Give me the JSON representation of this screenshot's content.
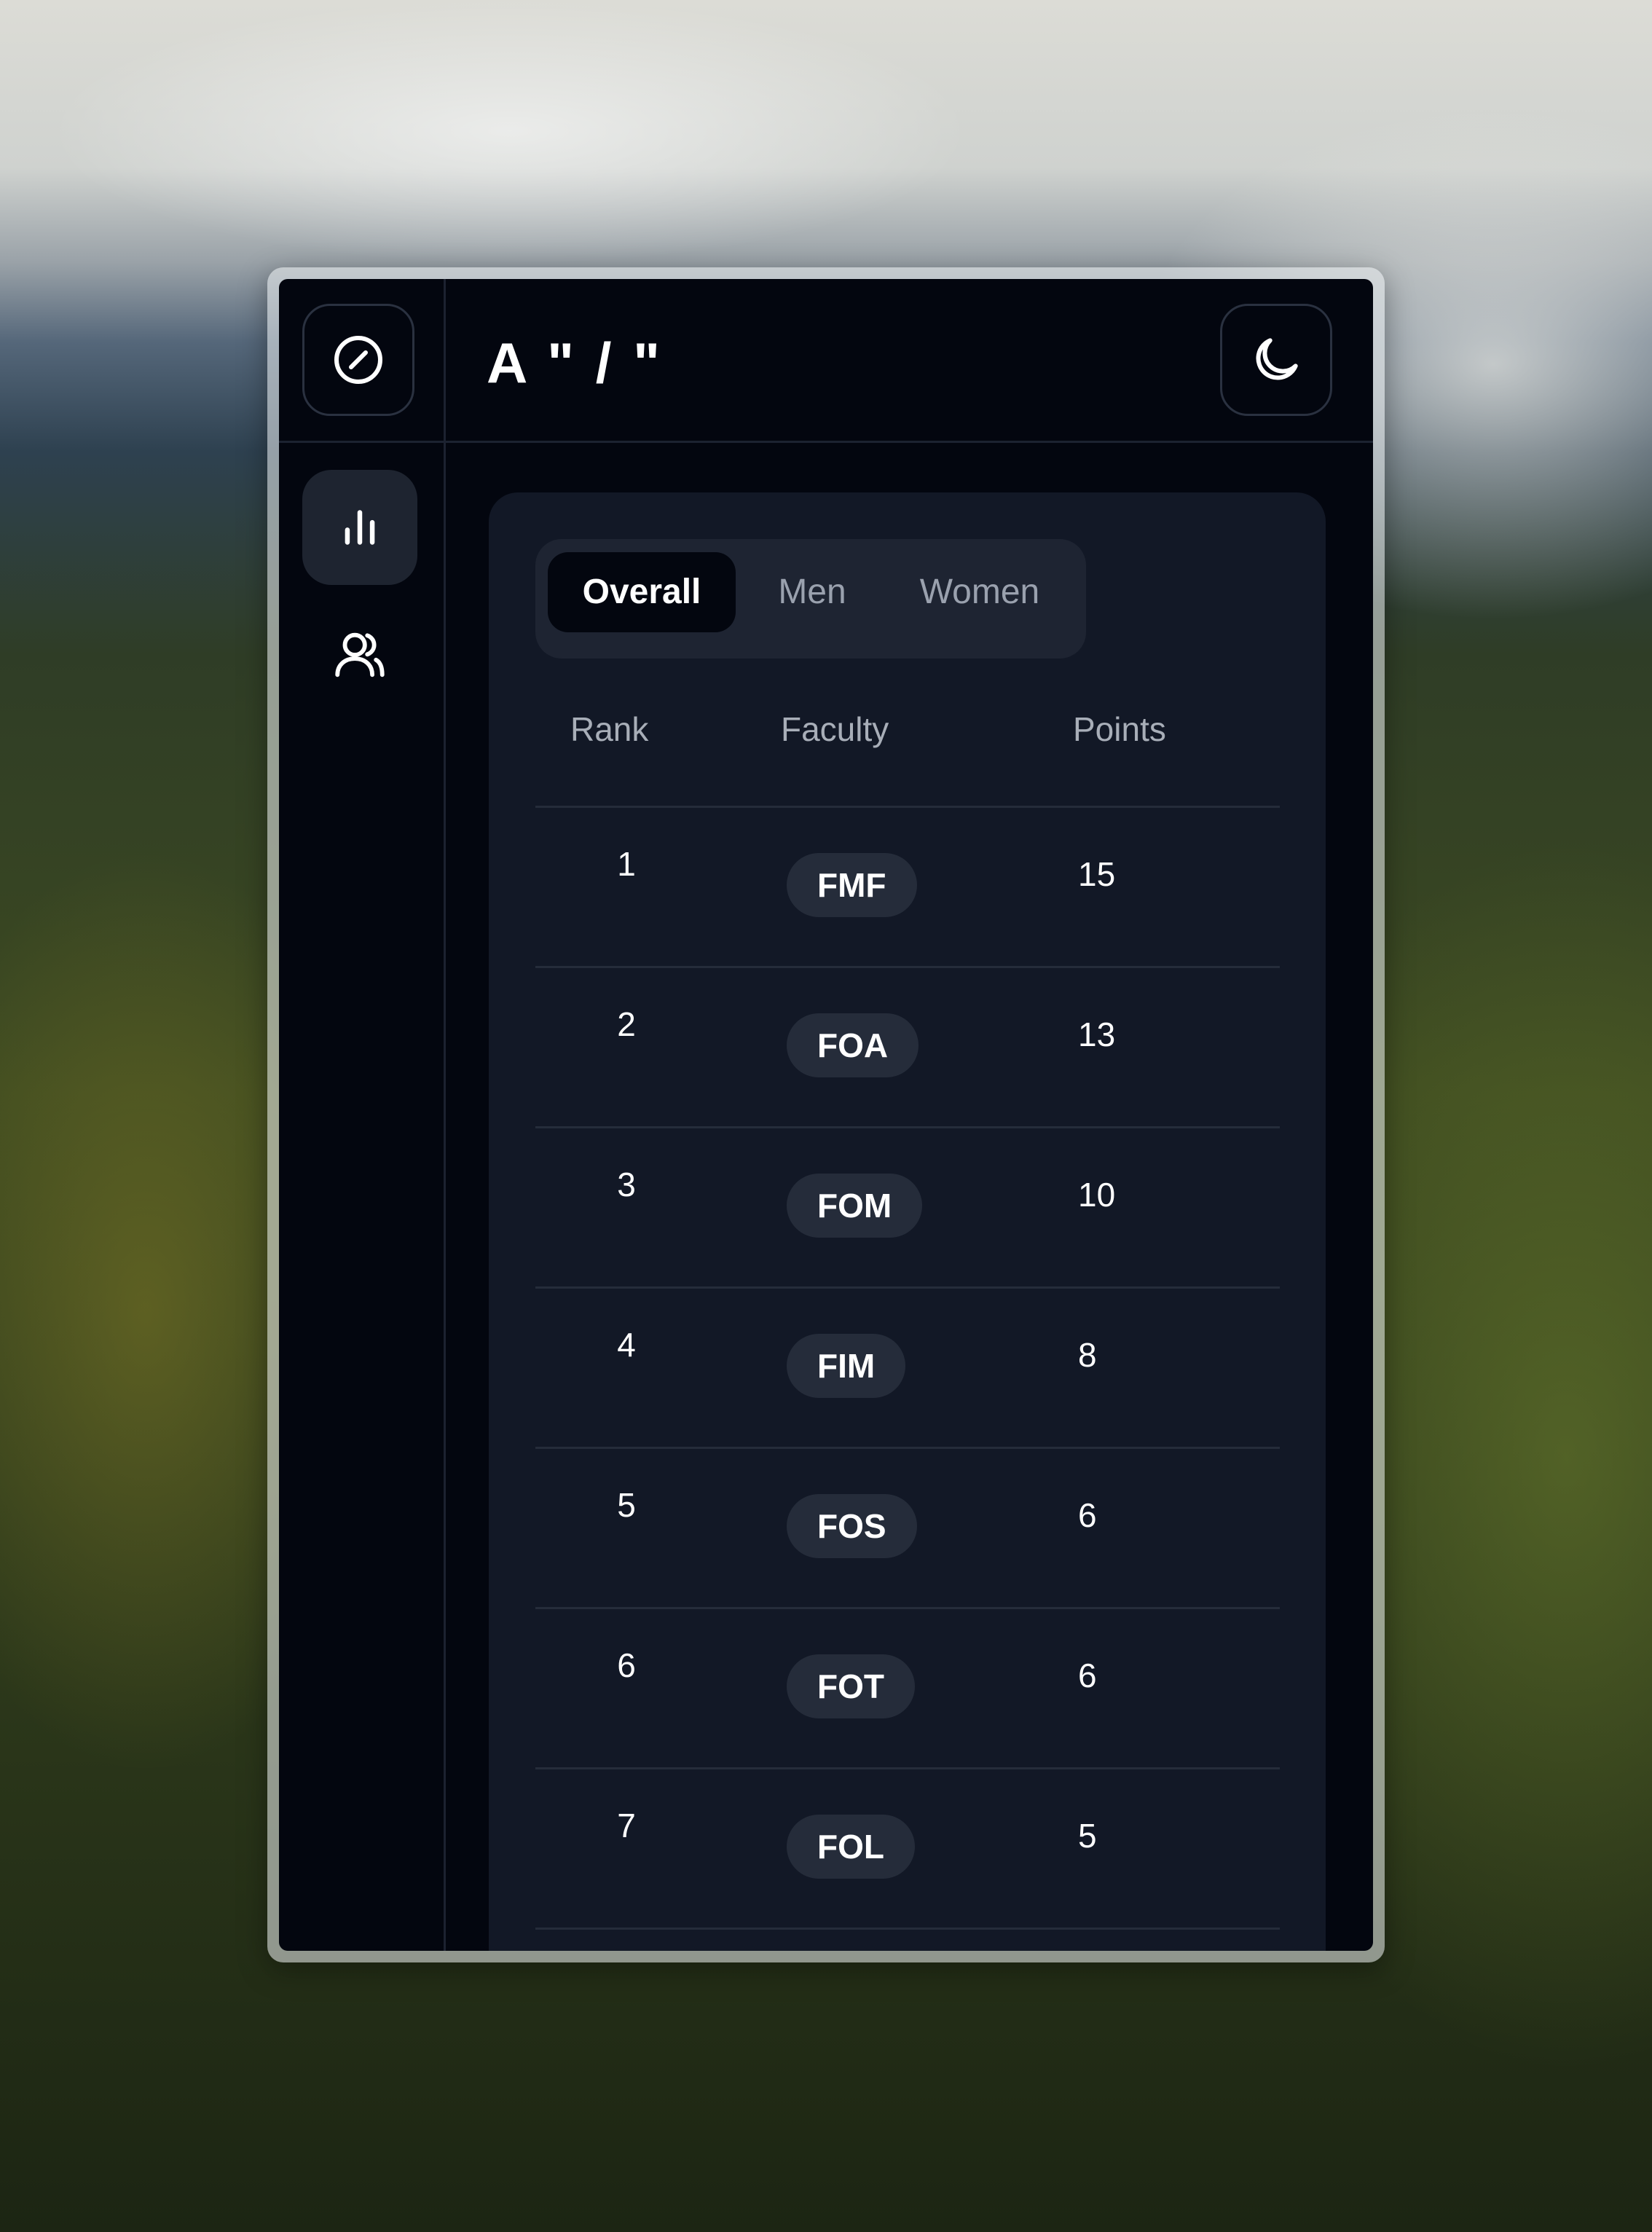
{
  "app": {
    "brand": "A \" / \""
  },
  "header": {
    "logo_icon": "compass-icon",
    "theme_icon": "moon-icon"
  },
  "sidebar": {
    "items": [
      {
        "icon": "bar-chart-icon",
        "active": true
      },
      {
        "icon": "users-icon",
        "active": false
      }
    ]
  },
  "tabs": [
    {
      "label": "Overall",
      "active": true
    },
    {
      "label": "Men",
      "active": false
    },
    {
      "label": "Women",
      "active": false
    }
  ],
  "table": {
    "columns": [
      "Rank",
      "Faculty",
      "Points"
    ],
    "rows": [
      {
        "rank": "1",
        "faculty": "FMF",
        "points": "15"
      },
      {
        "rank": "2",
        "faculty": "FOA",
        "points": "13"
      },
      {
        "rank": "3",
        "faculty": "FOM",
        "points": "10"
      },
      {
        "rank": "4",
        "faculty": "FIM",
        "points": "8"
      },
      {
        "rank": "5",
        "faculty": "FOS",
        "points": "6"
      },
      {
        "rank": "6",
        "faculty": "FOT",
        "points": "6"
      },
      {
        "rank": "7",
        "faculty": "FOL",
        "points": "5"
      }
    ]
  },
  "colors": {
    "app_bg": "#03060f",
    "card_bg": "#121826",
    "pill_bg": "#252c3a"
  }
}
